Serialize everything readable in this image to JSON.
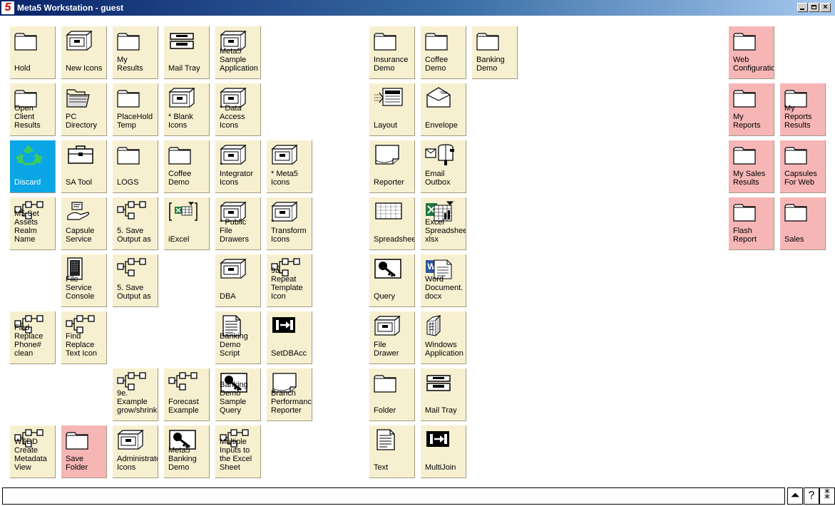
{
  "window": {
    "title": "Meta5 Workstation - guest",
    "logo": "5"
  },
  "icons": [
    {
      "id": "hold",
      "label": "Hold",
      "icon": "folder-icon",
      "color": "cream",
      "interactable": true
    },
    {
      "id": "new-icons",
      "label": "New Icons",
      "icon": "cabinet-icon",
      "color": "cream",
      "interactable": true
    },
    {
      "id": "my-results",
      "label": "My\nResults",
      "icon": "folder-icon",
      "color": "cream",
      "interactable": true
    },
    {
      "id": "mail-tray-1",
      "label": "Mail Tray",
      "icon": "tray-icon",
      "color": "cream",
      "interactable": true
    },
    {
      "id": "meta5-sample-app",
      "label": "Meta5\nSample\nApplication",
      "icon": "cabinet-icon",
      "color": "cream",
      "interactable": true
    },
    {
      "id": "insurance-demo",
      "label": "Insurance\nDemo",
      "icon": "folder-icon",
      "color": "cream",
      "interactable": true
    },
    {
      "id": "coffee-demo-1",
      "label": "Coffee\nDemo",
      "icon": "folder-icon",
      "color": "cream",
      "interactable": true
    },
    {
      "id": "banking-demo",
      "label": "Banking\nDemo",
      "icon": "folder-icon",
      "color": "cream",
      "interactable": true
    },
    {
      "id": "web-configuration",
      "label": "Web\nConfiguration",
      "icon": "folder-icon",
      "color": "pink",
      "interactable": true
    },
    {
      "id": "open-client-results",
      "label": "Open\nClient\nResults",
      "icon": "folder-icon",
      "color": "cream",
      "interactable": true
    },
    {
      "id": "pc-directory",
      "label": "PC\nDirectory",
      "icon": "open-folder-icon",
      "color": "cream",
      "interactable": true
    },
    {
      "id": "placehold-temp",
      "label": "PlaceHold\nTemp",
      "icon": "folder-icon",
      "color": "cream",
      "interactable": true
    },
    {
      "id": "blank-icons",
      "label": "* Blank\nIcons",
      "icon": "cabinet-icon",
      "color": "cream",
      "interactable": true
    },
    {
      "id": "data-access-icons",
      "label": "* Data\nAccess\nIcons",
      "icon": "cabinet-icon",
      "color": "cream",
      "interactable": true
    },
    {
      "id": "layout",
      "label": "Layout",
      "icon": "layout-icon",
      "color": "cream",
      "interactable": true
    },
    {
      "id": "envelope",
      "label": "Envelope",
      "icon": "envelope-icon",
      "color": "cream",
      "interactable": true
    },
    {
      "id": "my-reports",
      "label": "My\nReports",
      "icon": "folder-icon",
      "color": "pink",
      "interactable": true
    },
    {
      "id": "my-reports-results",
      "label": "My\nReports\nResults",
      "icon": "folder-icon",
      "color": "pink",
      "interactable": true
    },
    {
      "id": "discard",
      "label": "Discard",
      "icon": "recycle-icon",
      "color": "blue",
      "interactable": true
    },
    {
      "id": "sa-tool",
      "label": "SA Tool",
      "icon": "toolbox-icon",
      "color": "cream",
      "interactable": true
    },
    {
      "id": "logs",
      "label": "LOGS",
      "icon": "folder-icon",
      "color": "cream",
      "interactable": true
    },
    {
      "id": "coffee-demo-2",
      "label": "Coffee\nDemo",
      "icon": "folder-icon",
      "color": "cream",
      "interactable": true
    },
    {
      "id": "integrator-icons",
      "label": "*\nIntegrator\nIcons",
      "icon": "cabinet-icon",
      "color": "cream",
      "interactable": true
    },
    {
      "id": "meta5-icons",
      "label": "* Meta5\nIcons",
      "icon": "cabinet-icon",
      "color": "cream",
      "interactable": true
    },
    {
      "id": "reporter",
      "label": "Reporter",
      "icon": "reporter-icon",
      "color": "cream",
      "interactable": true
    },
    {
      "id": "email-outbox",
      "label": "Email\nOutbox",
      "icon": "mailbox-icon",
      "color": "cream",
      "interactable": true
    },
    {
      "id": "my-sales-results",
      "label": "My Sales\nResults",
      "icon": "folder-icon",
      "color": "pink",
      "interactable": true
    },
    {
      "id": "capsules-for-web",
      "label": "Capsules\nFor Web",
      "icon": "folder-icon",
      "color": "pink",
      "interactable": true
    },
    {
      "id": "m5-set-assets",
      "label": "M5 Set\nAssets\nRealm Name",
      "icon": "flow-icon",
      "color": "cream",
      "interactable": true
    },
    {
      "id": "capsule-service",
      "label": "Capsule\nService",
      "icon": "service-icon",
      "color": "cream",
      "interactable": true
    },
    {
      "id": "save-output-1",
      "label": "5. Save\nOutput as",
      "icon": "flow-icon",
      "color": "cream",
      "interactable": true
    },
    {
      "id": "iexcel",
      "label": "iExcel",
      "icon": "excel-bracket-icon",
      "color": "cream",
      "interactable": true
    },
    {
      "id": "public-file-drawers",
      "label": "* Public\nFile\nDrawers",
      "icon": "cabinet-icon",
      "color": "cream",
      "interactable": true
    },
    {
      "id": "transform-icons",
      "label": "*\nTransform\nIcons",
      "icon": "cabinet-icon",
      "color": "cream",
      "interactable": true
    },
    {
      "id": "spreadsheet",
      "label": "Spreadsheet",
      "icon": "spreadsheet-icon",
      "color": "cream",
      "interactable": true
    },
    {
      "id": "excel-spreadsheet",
      "label": "Excel\nSpreadsheet\nxlsx",
      "icon": "excel-icon",
      "color": "cream",
      "interactable": true
    },
    {
      "id": "flash-report",
      "label": "Flash\nReport",
      "icon": "folder-icon",
      "color": "pink",
      "interactable": true
    },
    {
      "id": "sales",
      "label": "Sales",
      "icon": "folder-icon",
      "color": "pink",
      "interactable": true
    },
    {
      "id": "file-service-console",
      "label": "File\nService\nConsole",
      "icon": "console-icon",
      "color": "cream",
      "interactable": true
    },
    {
      "id": "save-output-2",
      "label": "5. Save\nOutput as",
      "icon": "flow-icon",
      "color": "cream",
      "interactable": true
    },
    {
      "id": "dba",
      "label": "DBA",
      "icon": "cabinet-icon",
      "color": "cream",
      "interactable": true
    },
    {
      "id": "repeat-template",
      "label": "9a.\nRepeat\nTemplate Icon",
      "icon": "flow-icon",
      "color": "cream",
      "interactable": true
    },
    {
      "id": "query",
      "label": "Query",
      "icon": "query-icon",
      "color": "cream",
      "interactable": true
    },
    {
      "id": "word-document",
      "label": "Word\nDocument.\ndocx",
      "icon": "word-icon",
      "color": "cream",
      "interactable": true
    },
    {
      "id": "find-replace-phone",
      "label": "Find\nReplace\nPhone# clean",
      "icon": "flow-icon",
      "color": "cream",
      "interactable": true
    },
    {
      "id": "find-replace-text",
      "label": "Find\nReplace\nText Icon",
      "icon": "flow-icon",
      "color": "cream",
      "interactable": true
    },
    {
      "id": "banking-demo-script",
      "label": "Banking\nDemo\nScript",
      "icon": "document-icon",
      "color": "cream",
      "interactable": true
    },
    {
      "id": "setdbacc",
      "label": "SetDBAcc",
      "icon": "join-icon",
      "color": "cream",
      "interactable": true
    },
    {
      "id": "file-drawer",
      "label": "File\nDrawer",
      "icon": "cabinet-icon",
      "color": "cream",
      "interactable": true
    },
    {
      "id": "windows-application",
      "label": "Windows\nApplication",
      "icon": "windows-icon",
      "color": "cream",
      "interactable": true
    },
    {
      "id": "example-grow",
      "label": "9e.\nExample\ngrow/shrink",
      "icon": "flow-icon",
      "color": "cream",
      "interactable": true
    },
    {
      "id": "forecast-example",
      "label": "Forecast\nExample",
      "icon": "flow-icon",
      "color": "cream",
      "interactable": true
    },
    {
      "id": "banking-demo-sample-query",
      "label": "Banking\nDemo\nSample Query",
      "icon": "query-icon",
      "color": "cream",
      "interactable": true
    },
    {
      "id": "branch-performance-reporter",
      "label": "Branch\nPerformance\nReporter",
      "icon": "reporter-icon",
      "color": "cream",
      "interactable": true
    },
    {
      "id": "folder",
      "label": "Folder",
      "icon": "folder-icon",
      "color": "cream",
      "interactable": true
    },
    {
      "id": "mail-tray-2",
      "label": "Mail Tray",
      "icon": "tray-icon",
      "color": "cream",
      "interactable": true
    },
    {
      "id": "wtdd-create-metadata",
      "label": "WTDD\nCreate\nMetadata View",
      "icon": "flow-icon",
      "color": "cream",
      "interactable": true
    },
    {
      "id": "save-folder",
      "label": "Save\nFolder",
      "icon": "folder-icon",
      "color": "pink",
      "interactable": true
    },
    {
      "id": "administrator-icons",
      "label": "Administrator\nIcons",
      "icon": "cabinet-icon",
      "color": "cream",
      "interactable": true
    },
    {
      "id": "meta5-banking-demo",
      "label": "Meta5\nBanking\nDemo",
      "icon": "query-icon",
      "color": "cream",
      "interactable": true
    },
    {
      "id": "multiple-inputs",
      "label": "Multiple\nInputs to\nthe Excel Sheet",
      "icon": "flow-icon",
      "color": "cream",
      "interactable": true
    },
    {
      "id": "text",
      "label": "Text",
      "icon": "document-icon",
      "color": "cream",
      "interactable": true
    },
    {
      "id": "multijoin",
      "label": "MultiJoin",
      "icon": "join-icon",
      "color": "cream",
      "interactable": true
    }
  ],
  "bottom": {
    "command_value": "",
    "up_label": "⏶",
    "help_label": "?",
    "star_label": "⁑"
  }
}
